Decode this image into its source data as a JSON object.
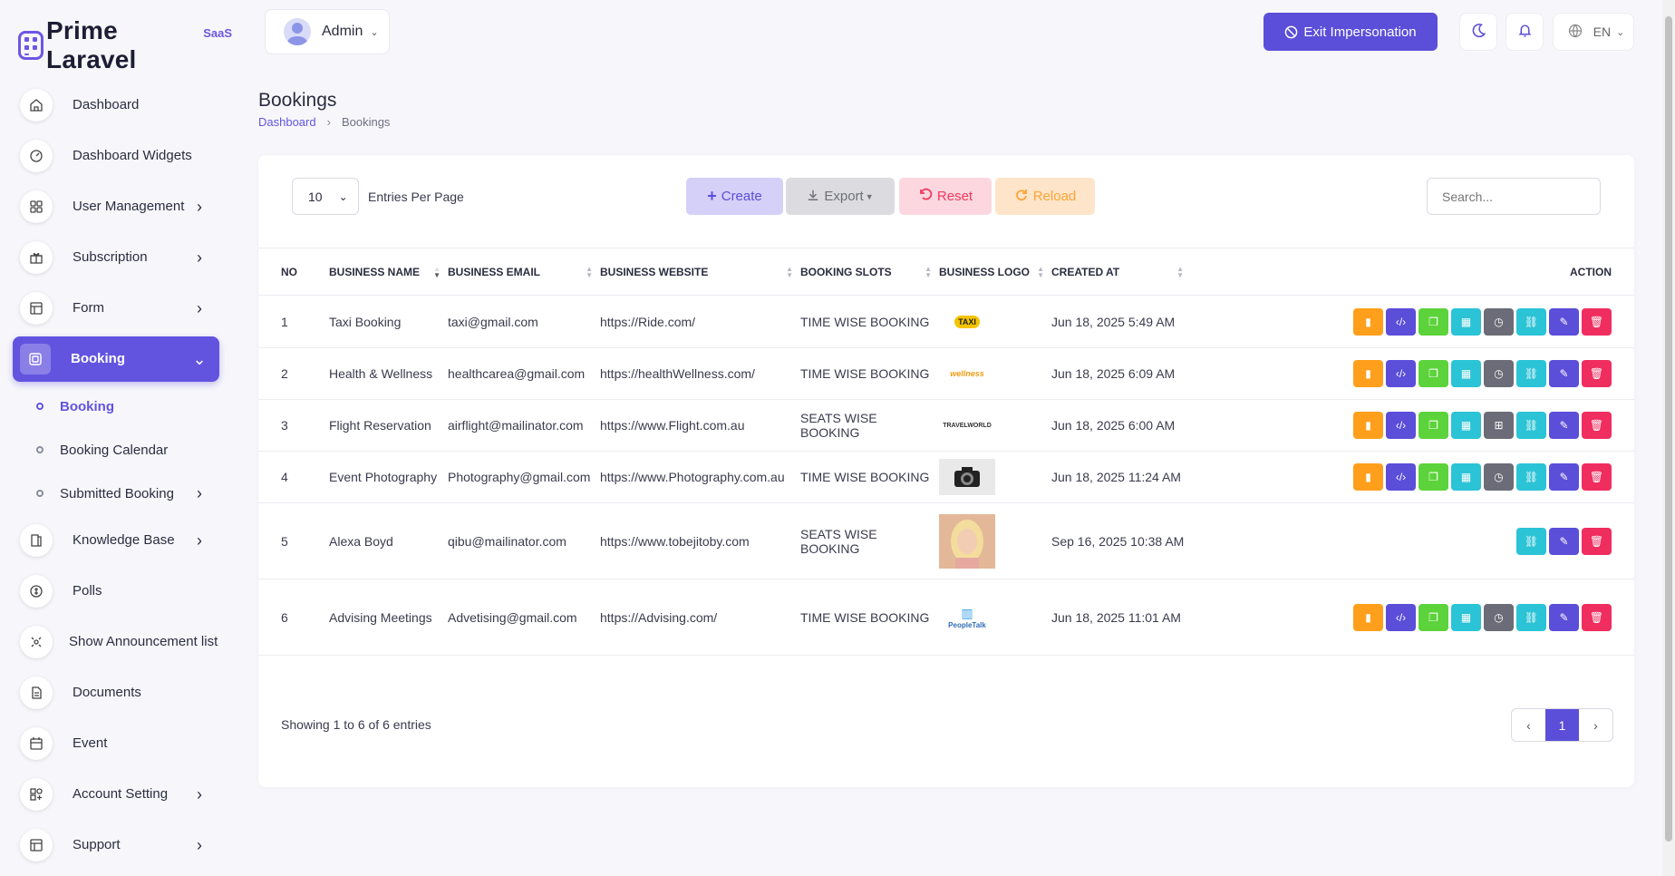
{
  "brand": {
    "name": "Prime Laravel",
    "sup": "SaaS"
  },
  "topbar": {
    "user": "Admin",
    "exit_label": "Exit Impersonation",
    "lang": "EN"
  },
  "sidebar": {
    "items": [
      {
        "label": "Dashboard"
      },
      {
        "label": "Dashboard Widgets"
      },
      {
        "label": "User Management"
      },
      {
        "label": "Subscription"
      },
      {
        "label": "Form"
      },
      {
        "label": "Booking"
      },
      {
        "label": "Knowledge Base"
      },
      {
        "label": "Polls"
      },
      {
        "label": "Show Announcement list"
      },
      {
        "label": "Documents"
      },
      {
        "label": "Event"
      },
      {
        "label": "Account Setting"
      },
      {
        "label": "Support"
      }
    ],
    "sub": [
      {
        "label": "Booking"
      },
      {
        "label": "Booking Calendar"
      },
      {
        "label": "Submitted Booking"
      }
    ]
  },
  "page": {
    "title": "Bookings",
    "breadcrumb_home": "Dashboard",
    "breadcrumb_current": "Bookings"
  },
  "toolbar": {
    "per_page": "10",
    "per_page_label": "Entries Per Page",
    "create": "Create",
    "export": "Export",
    "reset": "Reset",
    "reload": "Reload",
    "search_placeholder": "Search..."
  },
  "table": {
    "headers": [
      "NO",
      "BUSINESS NAME",
      "BUSINESS EMAIL",
      "BUSINESS WEBSITE",
      "BOOKING SLOTS",
      "BUSINESS LOGO",
      "CREATED AT",
      "ACTION"
    ],
    "rows": [
      {
        "no": "1",
        "name": "Taxi Booking",
        "email": "taxi@gmail.com",
        "website": "https://Ride.com/",
        "slots": "TIME WISE BOOKING",
        "logo": "TAXI",
        "created": "Jun 18, 2025 5:49 AM"
      },
      {
        "no": "2",
        "name": "Health & Wellness",
        "email": "healthcarea@gmail.com",
        "website": "https://healthWellness.com/",
        "slots": "TIME WISE BOOKING",
        "logo": "wellness",
        "created": "Jun 18, 2025 6:09 AM"
      },
      {
        "no": "3",
        "name": "Flight Reservation",
        "email": "airflight@mailinator.com",
        "website": "https://www.Flight.com.au",
        "slots": "SEATS WISE BOOKING",
        "logo": "TRAVELWORLD",
        "created": "Jun 18, 2025 6:00 AM"
      },
      {
        "no": "4",
        "name": "Event Photography",
        "email": "Photography@gmail.com",
        "website": "https://www.Photography.com.au",
        "slots": "TIME WISE BOOKING",
        "logo": "camera",
        "created": "Jun 18, 2025 11:24 AM"
      },
      {
        "no": "5",
        "name": "Alexa Boyd",
        "email": "qibu@mailinator.com",
        "website": "https://www.tobejitoby.com",
        "slots": "SEATS WISE BOOKING",
        "logo": "photo",
        "created": "Sep 16, 2025 10:38 AM"
      },
      {
        "no": "6",
        "name": "Advising Meetings",
        "email": "Advetising@gmail.com",
        "website": "https://Advising.com/",
        "slots": "TIME WISE BOOKING",
        "logo": "PeopleTalk",
        "created": "Jun 18, 2025 11:01 AM"
      }
    ]
  },
  "footer": {
    "showing": "Showing 1 to 6 of 6 entries",
    "page": "1"
  },
  "colors": {
    "accent": "#5b4ed8",
    "danger": "#f02d5f",
    "warning": "#ff9f1c",
    "success": "#5cd33b",
    "info": "#2bc3d6"
  }
}
